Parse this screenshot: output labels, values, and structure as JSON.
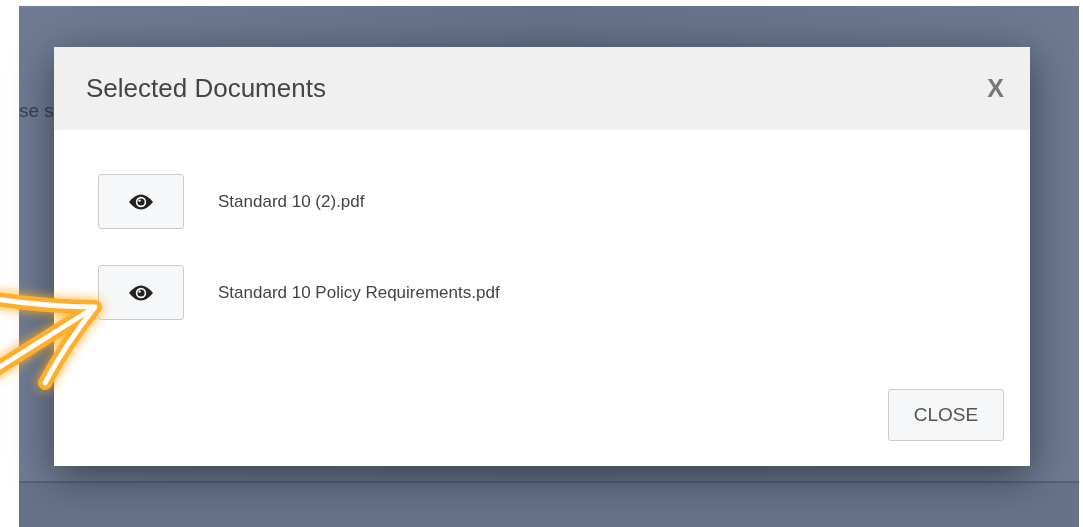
{
  "background_text": "se s",
  "modal": {
    "title": "Selected Documents",
    "close_icon": "X",
    "documents": [
      {
        "name": "Standard 10 (2).pdf"
      },
      {
        "name": "Standard 10 Policy Requirements.pdf"
      }
    ],
    "footer_button": "CLOSE"
  }
}
